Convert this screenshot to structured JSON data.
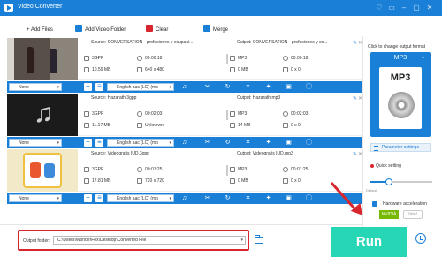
{
  "app": {
    "title": "Video Converter"
  },
  "window": {
    "buttons": [
      "♡",
      "▭",
      "–",
      "▢",
      "✕"
    ]
  },
  "toolbar": {
    "add_files": "+ Add Files",
    "add_folder": "Add Video Folder",
    "clear": "Clear",
    "merge": "Merge"
  },
  "colors": {
    "accent": "#1a7fd6",
    "run": "#26d6b4",
    "highlight": "#d9262e"
  },
  "tasks": [
    {
      "source": "Source: CONVERSATION - profesiones y ocupaci...",
      "src_format": "3GPP",
      "src_duration": "00:00:18",
      "src_size": "10.59 MB",
      "src_res": "640 x 480",
      "output": "Output: CONVERSATION - profesiones y oc...",
      "out_format": "MP3",
      "out_duration": "00:00:18",
      "out_size": "0 MB",
      "out_res": "0 x 0",
      "subtitle": "None",
      "audio": "English aac (LC) (mp"
    },
    {
      "source": "Source: Hazarath.3gpp",
      "src_format": "3GPP",
      "src_duration": "00:02:03",
      "src_size": "11.17 MB",
      "src_res": "Unknown",
      "output": "Output: Hazarath.mp3",
      "out_format": "MP3",
      "out_duration": "00:02:03",
      "out_size": "14 MB",
      "out_res": "0 x 0",
      "subtitle": "None",
      "audio": "English aac (LC) (mp"
    },
    {
      "source": "Source: Videografis IUD.3gpp",
      "src_format": "3GPP",
      "src_duration": "00:01:25",
      "src_size": "17.81 MB",
      "src_res": "720 x 720",
      "output": "Output: Videografis IUD.mp3",
      "out_format": "MP3",
      "out_duration": "00:01:25",
      "out_size": "0 MB",
      "out_res": "0 x 0",
      "subtitle": "None",
      "audio": "English aac (LC) (mp"
    }
  ],
  "right_panel": {
    "hint": "Click to change output format",
    "format": "MP3",
    "format_icon_text": "MP3",
    "parameter_settings": "Parameter settings",
    "quick_setting": "Quick setting",
    "quality_fraction": 0.3,
    "slider_label": "Default",
    "hardware_acceleration": "Hardware acceleration",
    "nvidia": "NVIDIA",
    "intel": "Intel"
  },
  "bottom": {
    "output_folder_label": "Output folder:",
    "output_folder_value": "C:\\Users\\WonderFox\\Desktop\\Converted File",
    "run": "Run"
  }
}
